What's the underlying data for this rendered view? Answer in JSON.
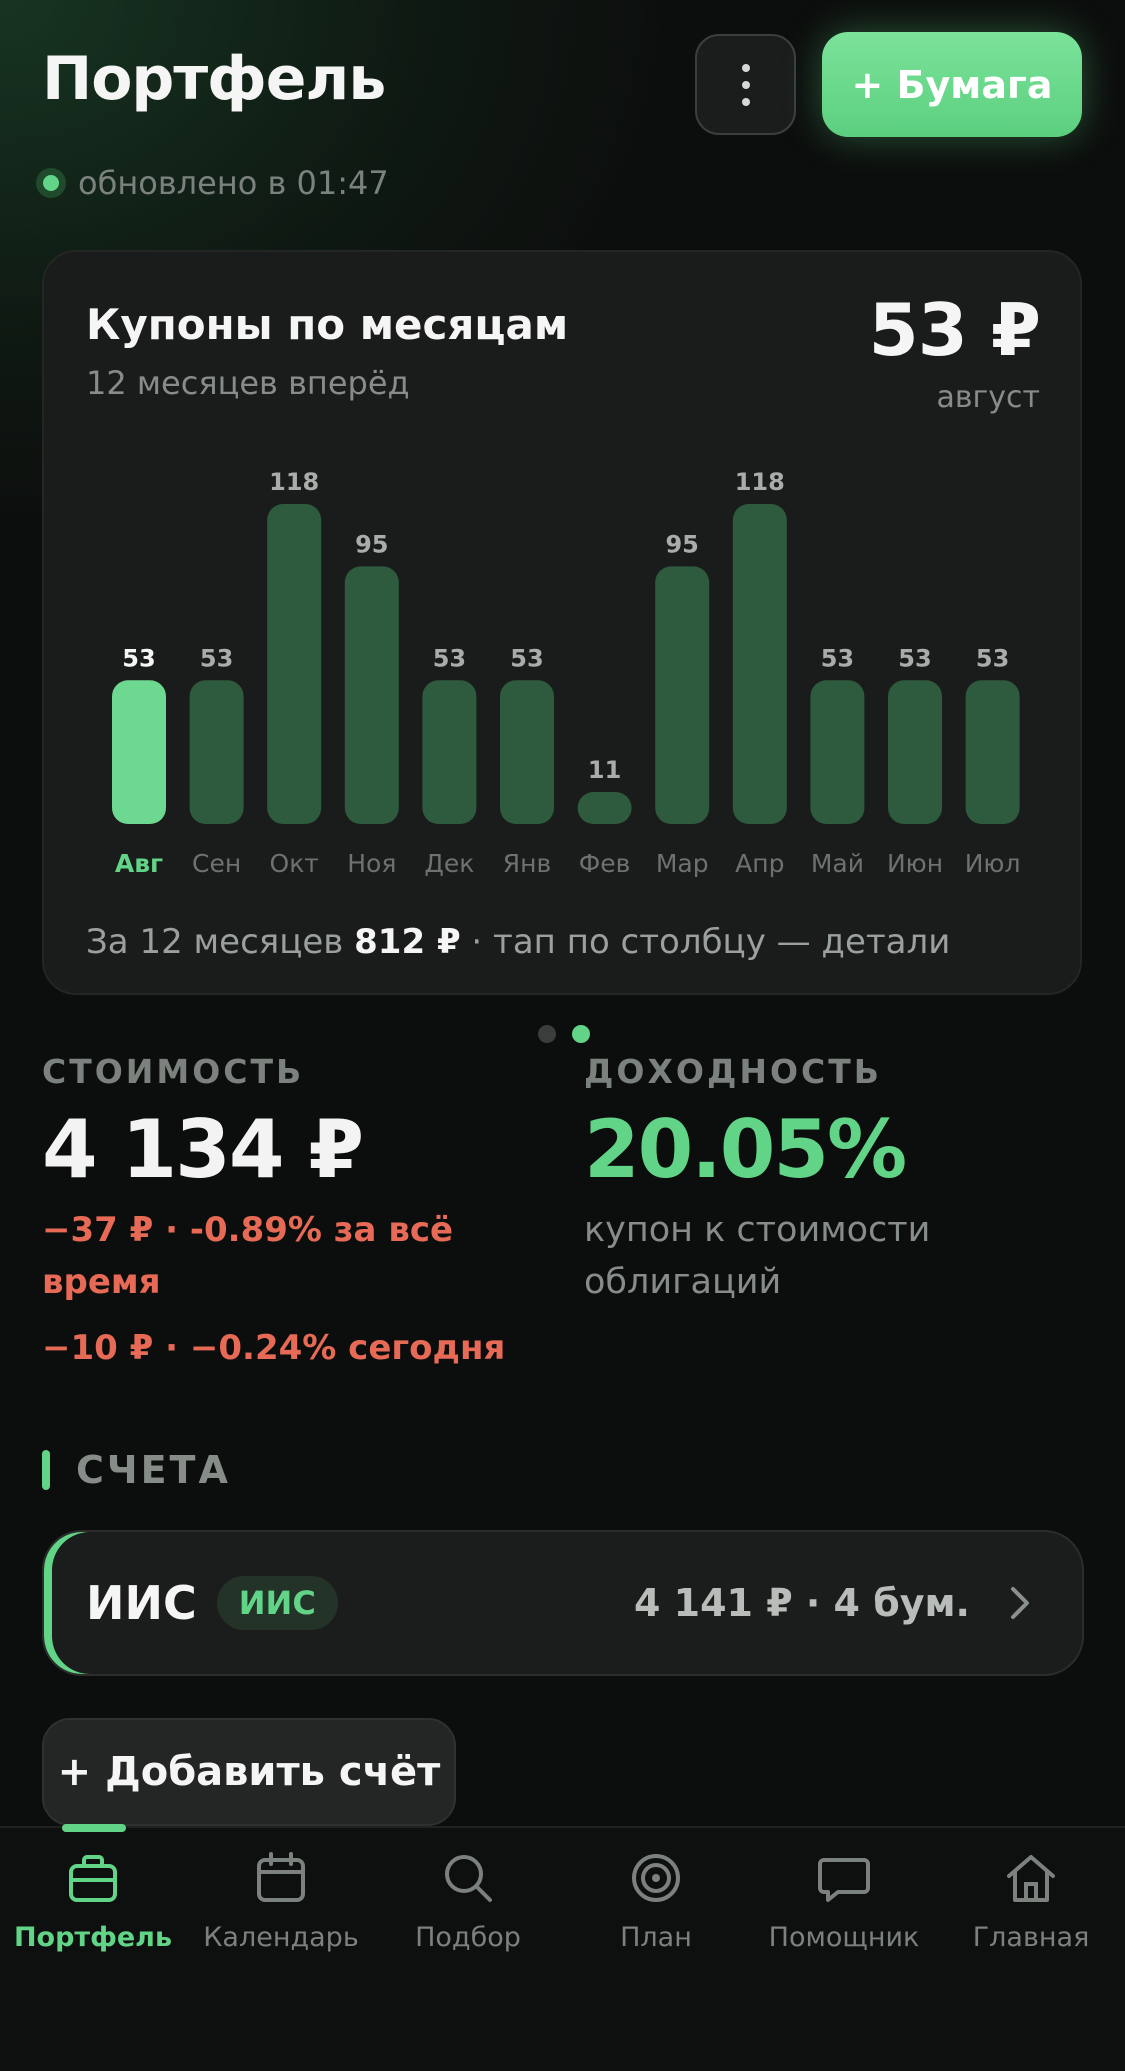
{
  "header": {
    "title": "Портфель",
    "add_paper_label": "+ Бумага"
  },
  "status": {
    "text": "обновлено в 01:47"
  },
  "coupon_card": {
    "title": "Купоны по месяцам",
    "subtitle": "12 месяцев вперёд",
    "total": "53 ₽",
    "month": "август",
    "footer_prefix": "За 12 месяцев",
    "footer_amount": "812 ₽",
    "footer_suffix": "· тап по столбцу — детали",
    "selected_index": 0
  },
  "chart_data": {
    "type": "bar",
    "categories": [
      "Авг",
      "Сен",
      "Окт",
      "Ноя",
      "Дек",
      "Янв",
      "Фев",
      "Мар",
      "Апр",
      "Май",
      "Июн",
      "Июл"
    ],
    "values": [
      53,
      53,
      118,
      95,
      53,
      53,
      11,
      95,
      118,
      53,
      53,
      53
    ],
    "data_labels": [
      "53",
      "53",
      "118",
      "95",
      "53",
      "53",
      "11",
      "95",
      "118",
      "53",
      "53",
      "53"
    ],
    "title": "Купоны по месяцам",
    "xlabel": "",
    "ylabel": "",
    "ylim": [
      0,
      118
    ],
    "grid": false,
    "colors": {
      "bar": "#2e5a3d",
      "bar_selected": "#6dd88f",
      "label": "#a8ada9",
      "label_selected": "#f4f5f4",
      "tick": "#6c726e",
      "tick_selected": "#62d487"
    }
  },
  "pager": {
    "count": 2,
    "active_index": 1
  },
  "value_stats": {
    "label": "СТОИМОСТЬ",
    "value": "4 134 ₽",
    "change_all_time": "−37 ₽ · -0.89% за всё время",
    "change_today": "−10 ₽ · −0.24% сегодня"
  },
  "yield_stats": {
    "label": "ДОХОДНОСТЬ",
    "value": "20.05%",
    "caption": "купон к стоимости облигаций"
  },
  "accounts": {
    "section_title": "СЧЕТА",
    "items": [
      {
        "name": "ИИС",
        "badge": "ИИС",
        "summary": "4 141 ₽ · 4 бум."
      }
    ],
    "add_label": "+ Добавить счёт"
  },
  "tabbar": {
    "tabs": [
      {
        "label": "Портфель",
        "icon": "briefcase-icon",
        "active": true
      },
      {
        "label": "Календарь",
        "icon": "calendar-icon",
        "active": false
      },
      {
        "label": "Подбор",
        "icon": "search-icon",
        "active": false
      },
      {
        "label": "План",
        "icon": "target-icon",
        "active": false
      },
      {
        "label": "Помощник",
        "icon": "chat-icon",
        "active": false
      },
      {
        "label": "Главная",
        "icon": "home-icon",
        "active": false
      }
    ]
  },
  "colors": {
    "accent": "#62d487",
    "negative": "#e66a55",
    "background": "#0c0e0d",
    "card": "#1a1c1b"
  }
}
